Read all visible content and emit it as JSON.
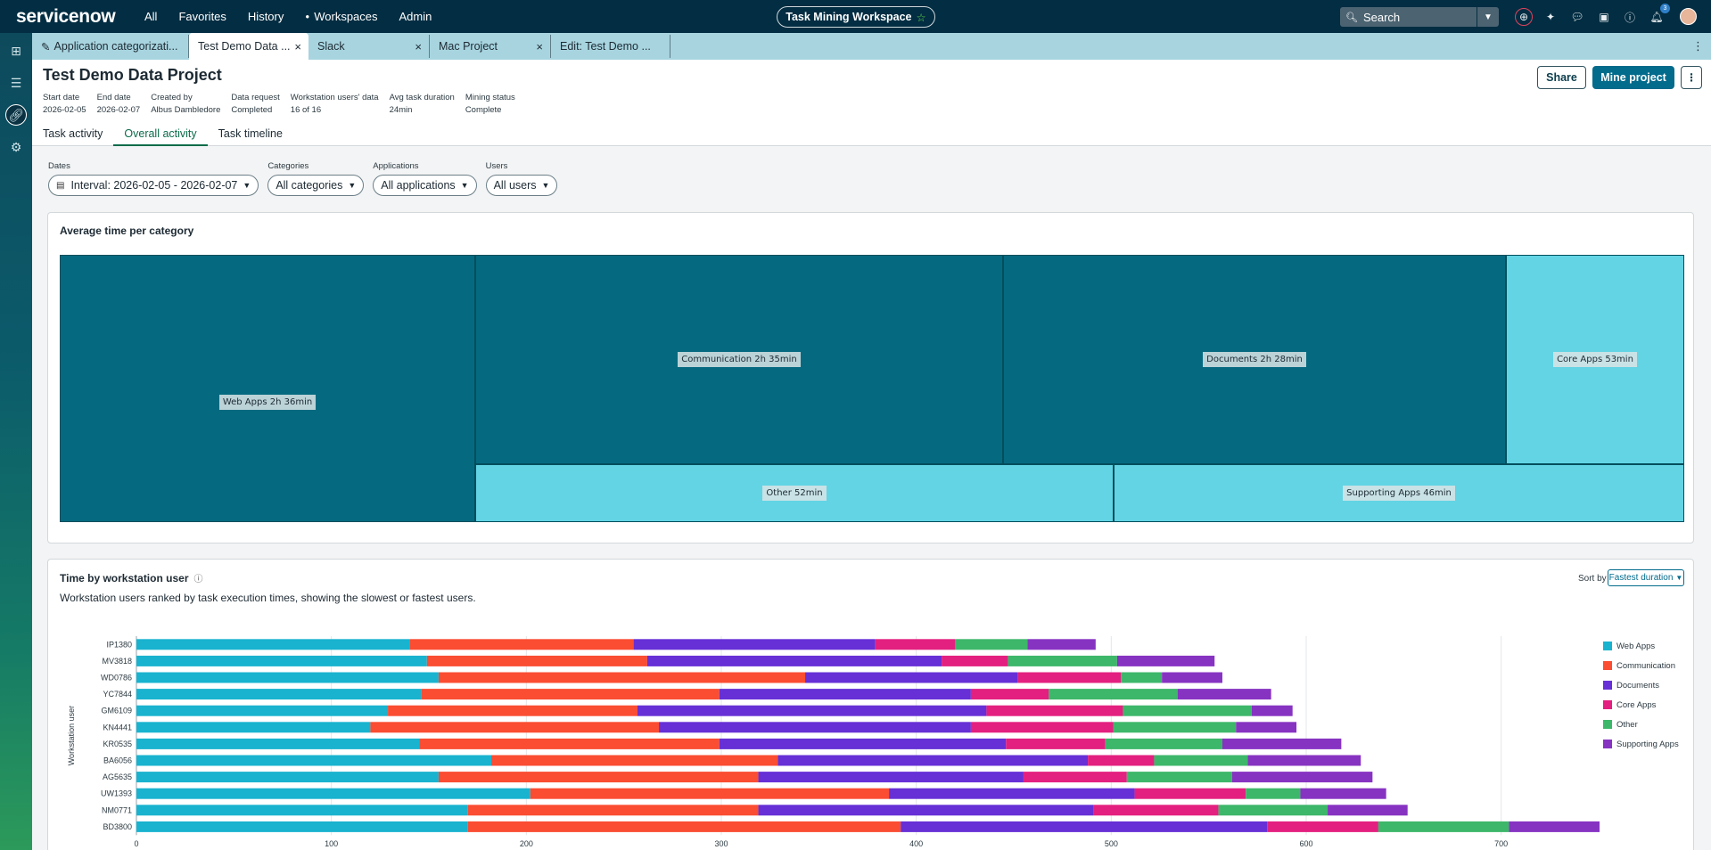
{
  "topnav": {
    "logo": "servicenow",
    "links": [
      "All",
      "Favorites",
      "History",
      "Workspaces",
      "Admin"
    ],
    "workspace_pill": "Task Mining Workspace",
    "search_placeholder": "Search",
    "notification_count": "3"
  },
  "tabs": [
    {
      "label": "Application categorizati...",
      "closable": false,
      "active": false
    },
    {
      "label": "Test Demo Data ...",
      "closable": true,
      "active": true
    },
    {
      "label": "Slack",
      "closable": true,
      "active": false
    },
    {
      "label": "Mac Project",
      "closable": true,
      "active": false
    },
    {
      "label": "Edit: Test Demo ...",
      "closable": false,
      "active": false
    }
  ],
  "header": {
    "title": "Test Demo Data Project",
    "meta": [
      {
        "label": "Start date",
        "value": "2026-02-05"
      },
      {
        "label": "End date",
        "value": "2026-02-07"
      },
      {
        "label": "Created by",
        "value": "Albus Dambledore"
      },
      {
        "label": "Data request",
        "value": "Completed"
      },
      {
        "label": "Workstation users' data",
        "value": "16 of 16"
      },
      {
        "label": "Avg task duration",
        "value": "24min"
      },
      {
        "label": "Mining status",
        "value": "Complete"
      }
    ],
    "share_label": "Share",
    "mine_label": "Mine project",
    "subtabs": [
      "Task activity",
      "Overall activity",
      "Task timeline"
    ],
    "active_subtab": "Overall activity"
  },
  "filters": [
    {
      "label": "Dates",
      "value": "Interval: 2026-02-05 - 2026-02-07"
    },
    {
      "label": "Categories",
      "value": "All categories"
    },
    {
      "label": "Applications",
      "value": "All applications"
    },
    {
      "label": "Users",
      "value": "All users"
    }
  ],
  "treemap_card": {
    "title": "Average time per category",
    "cells": [
      {
        "label": "Web Apps 2h 36min",
        "color": "#056a80"
      },
      {
        "label": "Communication 2h 35min",
        "color": "#056a80"
      },
      {
        "label": "Documents 2h 28min",
        "color": "#056a80"
      },
      {
        "label": "Core Apps 53min",
        "color": "#62d4e4"
      },
      {
        "label": "Other 52min",
        "color": "#62d4e4"
      },
      {
        "label": "Supporting Apps 46min",
        "color": "#62d4e4"
      }
    ]
  },
  "bar_card": {
    "title": "Time by workstation user",
    "subtitle": "Workstation users ranked by task execution times, showing the slowest or fastest users.",
    "sort_label": "Sort by",
    "sort_value": "Fastest duration"
  },
  "chart_data": {
    "type": "bar",
    "orientation": "horizontal",
    "stacked": true,
    "ylabel": "Workstation user",
    "categories": [
      "IP1380",
      "MV3818",
      "WD0786",
      "YC7844",
      "GM6109",
      "KN4441",
      "KR0535",
      "BA6056",
      "AG5635",
      "UW1393",
      "NM0771",
      "BD3800"
    ],
    "xlim": [
      0,
      750
    ],
    "xticks": [
      0,
      100,
      200,
      300,
      400,
      500,
      600,
      700
    ],
    "series": [
      {
        "name": "Web Apps",
        "color": "#19b3cf",
        "values": [
          140,
          149,
          155,
          146,
          129,
          120,
          145,
          182,
          155,
          202,
          170,
          170
        ]
      },
      {
        "name": "Communication",
        "color": "#fa4d32",
        "values": [
          115,
          113,
          188,
          153,
          128,
          148,
          154,
          147,
          164,
          184,
          149,
          222
        ]
      },
      {
        "name": "Documents",
        "color": "#6630d6",
        "values": [
          124,
          151,
          109,
          129,
          179,
          160,
          147,
          159,
          136,
          126,
          172,
          188
        ]
      },
      {
        "name": "Core Apps",
        "color": "#e3207f",
        "values": [
          41,
          34,
          53,
          40,
          70,
          73,
          51,
          34,
          53,
          57,
          64,
          57
        ]
      },
      {
        "name": "Other",
        "color": "#3db76a",
        "values": [
          37,
          56,
          21,
          66,
          66,
          63,
          60,
          48,
          54,
          28,
          56,
          67
        ]
      },
      {
        "name": "Supporting Apps",
        "color": "#8733c2",
        "values": [
          35,
          50,
          31,
          48,
          21,
          31,
          61,
          58,
          72,
          44,
          41,
          63
        ]
      }
    ]
  }
}
